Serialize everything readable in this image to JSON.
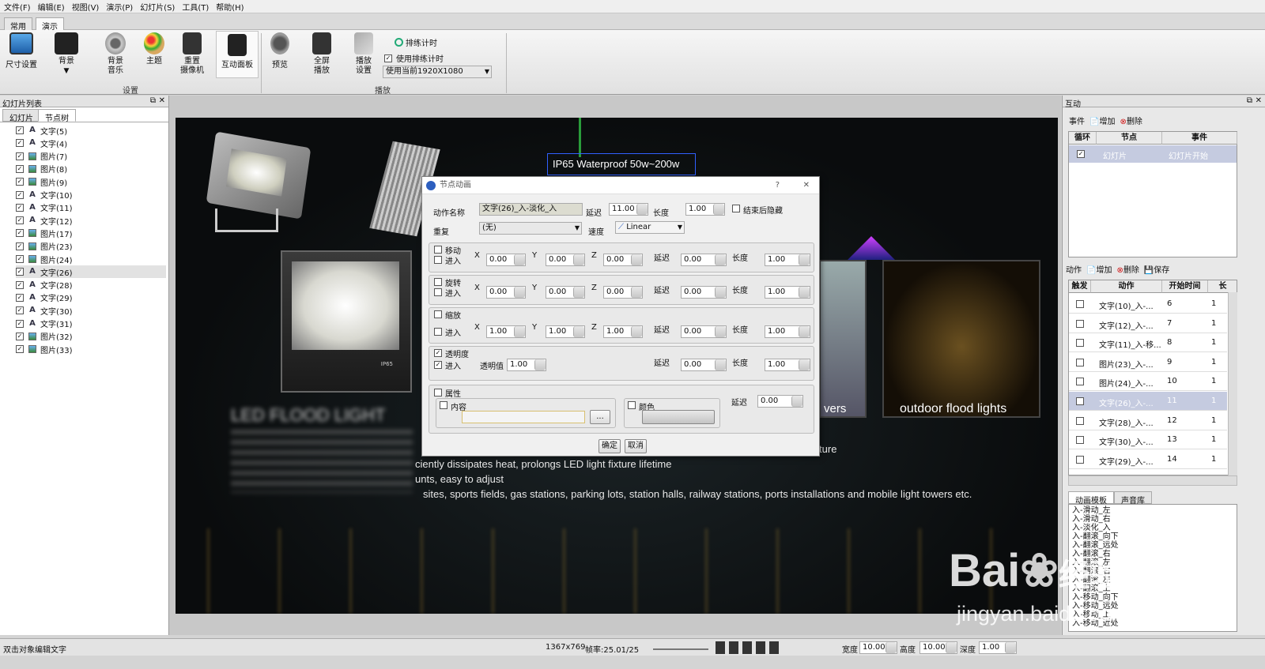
{
  "menu": [
    "文件(F)",
    "编辑(E)",
    "视图(V)",
    "演示(P)",
    "幻灯片(S)",
    "工具(T)",
    "帮助(H)"
  ],
  "tabs": {
    "normal": "常用",
    "present": "演示"
  },
  "ribbon": {
    "size": "尺寸设置",
    "bg": "背景",
    "bgmusic": "背景\n音乐",
    "theme": "主题",
    "resetcam": "重置\n摄像机",
    "interact": "互动面板",
    "preview": "预览",
    "fullscreen": "全屏\n播放",
    "playset": "播放\n设置",
    "rehearse": "排练计时",
    "use_rehearse": "使用排练计时",
    "resolution": "使用当前1920X1080",
    "group_settings": "设置",
    "group_play": "播放"
  },
  "left": {
    "title": "幻灯片列表",
    "tab_slides": "幻灯片",
    "tab_nodes": "节点树",
    "items": [
      {
        "type": "text",
        "label": "文字(5)"
      },
      {
        "type": "text",
        "label": "文字(4)"
      },
      {
        "type": "image",
        "label": "图片(7)"
      },
      {
        "type": "image",
        "label": "图片(8)"
      },
      {
        "type": "image",
        "label": "图片(9)"
      },
      {
        "type": "text",
        "label": "文字(10)"
      },
      {
        "type": "text",
        "label": "文字(11)"
      },
      {
        "type": "text",
        "label": "文字(12)"
      },
      {
        "type": "image",
        "label": "图片(17)"
      },
      {
        "type": "image",
        "label": "图片(23)"
      },
      {
        "type": "image",
        "label": "图片(24)"
      },
      {
        "type": "text",
        "label": "文字(26)"
      },
      {
        "type": "text",
        "label": "文字(28)"
      },
      {
        "type": "text",
        "label": "文字(29)"
      },
      {
        "type": "text",
        "label": "文字(30)"
      },
      {
        "type": "text",
        "label": "文字(31)"
      },
      {
        "type": "image",
        "label": "图片(32)"
      },
      {
        "type": "image",
        "label": "图片(33)"
      }
    ]
  },
  "canvas": {
    "ip65": "IP65 Waterproof  50w~200w",
    "heading": "LED FLOOD LIGHT",
    "line1": "ciently dissipates heat, prolongs LED light fixture lifetime",
    "line2": "unts, easy to adjust",
    "line3": "sites, sports fields, gas stations, parking lots, station halls, railway stations, ports installations and mobile light towers etc.",
    "perature": "perature",
    "photo1_caption": "vers",
    "photo2_caption": "outdoor flood lights",
    "lamp_mark": "IP65"
  },
  "dialog": {
    "title": "节点动画",
    "help": "?",
    "close": "✕",
    "action_name_label": "动作名称",
    "action_name": "文字(26)_入-淡化_入",
    "delay_label": "延迟",
    "delay": "11.00",
    "length_label": "长度",
    "length": "1.00",
    "hide_after": "结束后隐藏",
    "repeat_label": "重复",
    "repeat": "(无)",
    "speed_label": "速度",
    "speed": "Linear",
    "move": "移动",
    "rotate": "旋转",
    "scale": "缩放",
    "opacity": "透明度",
    "enter": "进入",
    "x": "X",
    "y": "Y",
    "z": "Z",
    "zero": "0.00",
    "one": "1.00",
    "opacity_value_label": "透明值",
    "attr": "属性",
    "content": "内容",
    "browse": "...",
    "color": "颜色",
    "ok": "确定",
    "cancel": "取消"
  },
  "right": {
    "title": "互动",
    "events_label": "事件",
    "add": "增加",
    "delete": "删除",
    "save": "保存",
    "event_cols": [
      "循环",
      "节点",
      "事件"
    ],
    "event_row": {
      "node": "幻灯片",
      "event": "幻灯片开始"
    },
    "actions_label": "动作",
    "action_cols": [
      "触发",
      "动作",
      "开始时间",
      "长"
    ],
    "actions": [
      {
        "name": "文字(10)_入-...",
        "start": "6",
        "len": "1"
      },
      {
        "name": "文字(12)_入-...",
        "start": "7",
        "len": "1"
      },
      {
        "name": "文字(11)_入-移...",
        "start": "8",
        "len": "1"
      },
      {
        "name": "图片(23)_入-...",
        "start": "9",
        "len": "1"
      },
      {
        "name": "图片(24)_入-...",
        "start": "10",
        "len": "1"
      },
      {
        "name": "文字(26)_入-...",
        "start": "11",
        "len": "1"
      },
      {
        "name": "文字(28)_入-...",
        "start": "12",
        "len": "1"
      },
      {
        "name": "文字(30)_入-...",
        "start": "13",
        "len": "1"
      },
      {
        "name": "文字(29)_入-...",
        "start": "14",
        "len": "1"
      }
    ],
    "tab_templates": "动画模板",
    "tab_sounds": "声音库",
    "templates": [
      "入-滑动_左",
      "入-滑动_右",
      "入-淡化_入",
      "入-翻滚_向下",
      "入-翻滚_远处",
      "入-翻滚_右",
      "入-翻滚_左",
      "入-翻滚_右",
      "入-翻滚_左",
      "入-翻滚_上",
      "入-移动_向下",
      "入-移动_远处",
      "入-移动_上",
      "入-移动_近处"
    ]
  },
  "status": {
    "hint": "双击对象编辑文字",
    "resolution": "1367x769",
    "fps": "帧率:25.01/25",
    "width_label": "宽度",
    "width": "10.00",
    "height_label": "高度",
    "height": "10.00",
    "depth_label": "深度",
    "depth": "1.00"
  },
  "watermark": {
    "brand": "Bai",
    "brand_cn": "经验",
    "url": "jingyan.baidu.com"
  },
  "colors": {
    "selection": "#c5cbe0",
    "accent_blue": "#2d5fbf",
    "close_red": "#d01818"
  }
}
